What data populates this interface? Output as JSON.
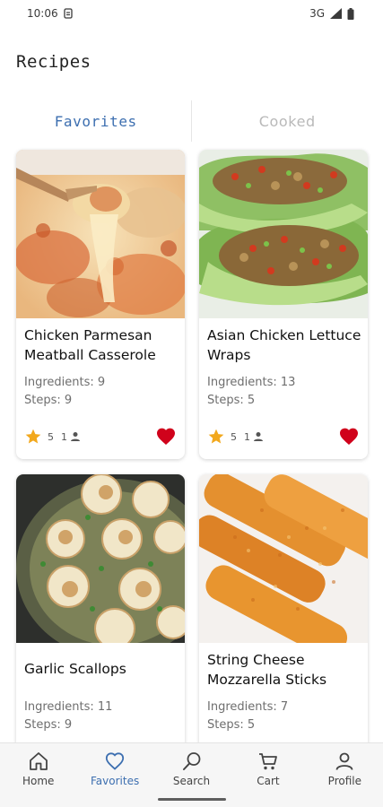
{
  "status_bar": {
    "time": "10:06",
    "network": "3G"
  },
  "page": {
    "title": "Recipes"
  },
  "tabs": [
    {
      "label": "Favorites",
      "active": true
    },
    {
      "label": "Cooked",
      "active": false
    }
  ],
  "recipes": [
    {
      "title": "Chicken Parmesan Meatball Casserole",
      "ingredients": "Ingredients: 9",
      "steps": "Steps: 9",
      "rating": "5",
      "cooks": "1",
      "favorite": true
    },
    {
      "title": "Asian Chicken Lettuce Wraps",
      "ingredients": "Ingredients: 13",
      "steps": "Steps: 5",
      "rating": "5",
      "cooks": "1",
      "favorite": true
    },
    {
      "title": "Garlic Scallops",
      "ingredients": "Ingredients: 11",
      "steps": "Steps: 9"
    },
    {
      "title": "String Cheese Mozzarella Sticks",
      "ingredients": "Ingredients: 7",
      "steps": "Steps: 5"
    }
  ],
  "bottom_nav": [
    {
      "label": "Home",
      "icon": "home-icon",
      "active": false
    },
    {
      "label": "Favorites",
      "icon": "heart-outline-icon",
      "active": true
    },
    {
      "label": "Search",
      "icon": "search-icon",
      "active": false
    },
    {
      "label": "Cart",
      "icon": "cart-icon",
      "active": false
    },
    {
      "label": "Profile",
      "icon": "person-icon",
      "active": false
    }
  ],
  "colors": {
    "accent": "#3d6fb0",
    "star": "#f2a81d",
    "heart": "#d0021b",
    "inactive_tab": "#b9b9b9"
  }
}
